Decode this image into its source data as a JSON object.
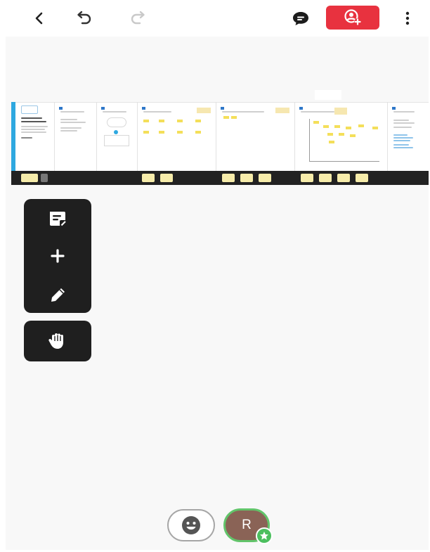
{
  "toolbar": {
    "icons": [
      "chevron-left-icon",
      "undo-icon",
      "redo-icon",
      "chat-icon",
      "add-user-icon",
      "more-vertical-icon"
    ],
    "share_color": "#e8323f"
  },
  "board": {
    "accent_color": "#2ea8e0",
    "sticky_color": "#f4df5a",
    "footer_color": "#222222"
  },
  "tools": {
    "items": [
      "sticky-note-icon",
      "plus-icon",
      "pen-icon",
      "hand-icon"
    ]
  },
  "bottom": {
    "avatar_initial": "R",
    "avatar_color": "#8a6356",
    "presence_color": "#62c46a"
  }
}
